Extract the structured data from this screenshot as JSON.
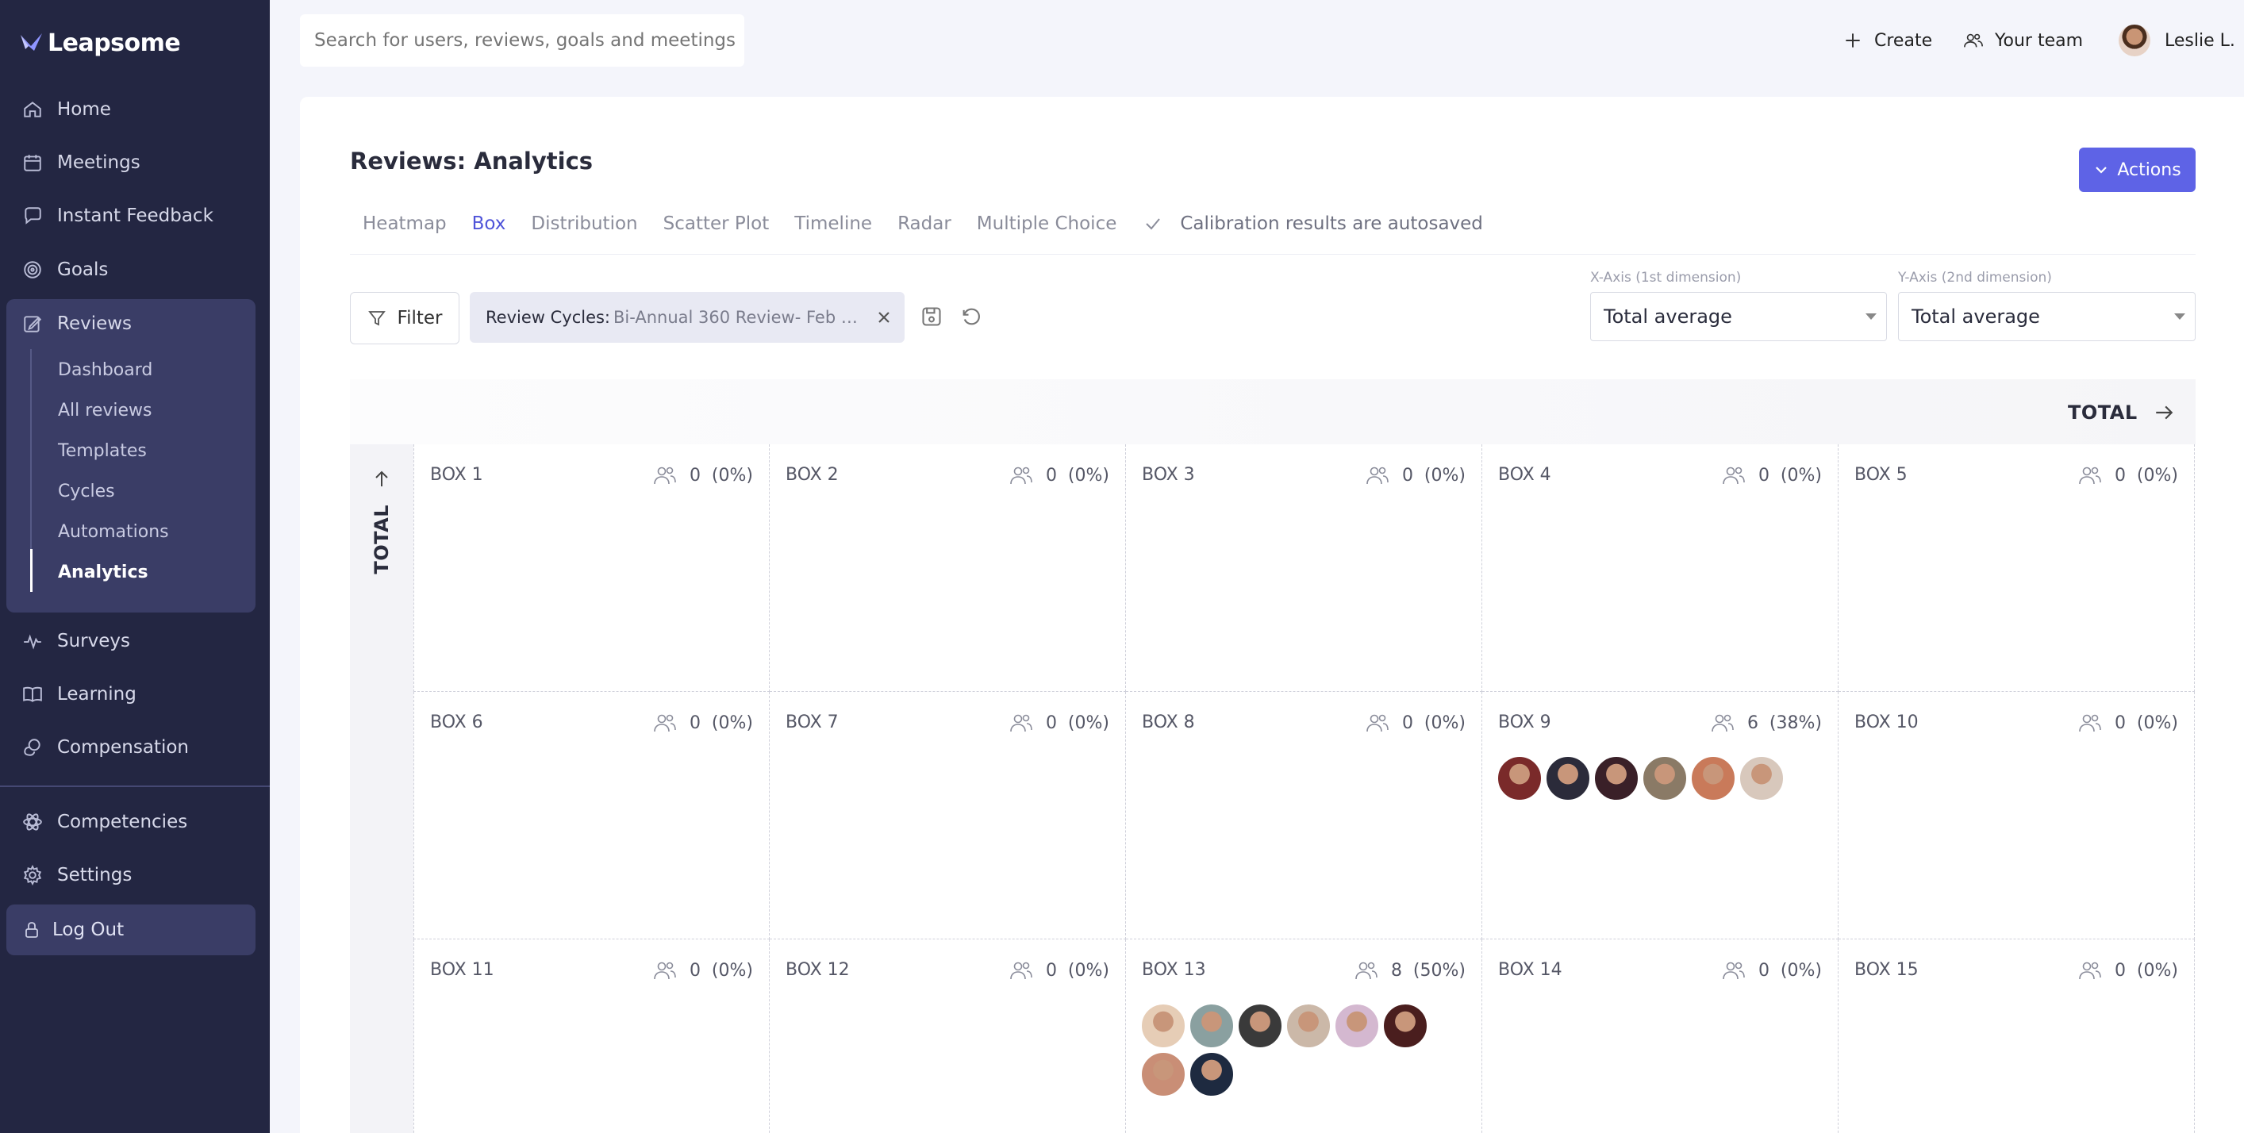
{
  "app": {
    "name": "Leapsome"
  },
  "sidebar": {
    "items": [
      {
        "id": "home",
        "label": "Home",
        "icon": "home-icon"
      },
      {
        "id": "meetings",
        "label": "Meetings",
        "icon": "calendar-icon"
      },
      {
        "id": "instant-feedback",
        "label": "Instant Feedback",
        "icon": "feedback-icon"
      },
      {
        "id": "goals",
        "label": "Goals",
        "icon": "target-icon"
      },
      {
        "id": "reviews",
        "label": "Reviews",
        "icon": "edit-icon"
      }
    ],
    "reviews_sub": [
      "Dashboard",
      "All reviews",
      "Templates",
      "Cycles",
      "Automations",
      "Analytics"
    ],
    "items_after": [
      {
        "id": "surveys",
        "label": "Surveys",
        "icon": "pulse-icon"
      },
      {
        "id": "learning",
        "label": "Learning",
        "icon": "book-icon"
      },
      {
        "id": "compensation",
        "label": "Compensation",
        "icon": "coins-icon"
      }
    ],
    "bottom": [
      {
        "id": "competencies",
        "label": "Competencies",
        "icon": "atom-icon"
      },
      {
        "id": "settings",
        "label": "Settings",
        "icon": "gear-icon"
      }
    ],
    "logout": "Log Out"
  },
  "topbar": {
    "search_placeholder": "Search for users, reviews, goals and meetings",
    "create": "Create",
    "your_team": "Your team",
    "user": "Leslie L."
  },
  "page": {
    "title": "Reviews: Analytics",
    "actions": "Actions",
    "tabs": [
      "Heatmap",
      "Box",
      "Distribution",
      "Scatter Plot",
      "Timeline",
      "Radar",
      "Multiple Choice"
    ],
    "active_tab": "Box",
    "autosave": "Calibration results are autosaved"
  },
  "filters": {
    "filter_label": "Filter",
    "chip_key": "Review Cycles:",
    "chip_value": "Bi-Annual 360 Review- Feb 1..."
  },
  "axes": {
    "x_label": "X-Axis (1st dimension)",
    "x_value": "Total average",
    "y_label": "Y-Axis (2nd dimension)",
    "y_value": "Total average"
  },
  "grid": {
    "x_header": "TOTAL",
    "y_header": "TOTAL",
    "boxes": [
      {
        "name": "BOX 1",
        "count": "0",
        "pct": "(0%)",
        "avatars": []
      },
      {
        "name": "BOX 2",
        "count": "0",
        "pct": "(0%)",
        "avatars": []
      },
      {
        "name": "BOX 3",
        "count": "0",
        "pct": "(0%)",
        "avatars": []
      },
      {
        "name": "BOX 4",
        "count": "0",
        "pct": "(0%)",
        "avatars": []
      },
      {
        "name": "BOX 5",
        "count": "0",
        "pct": "(0%)",
        "avatars": []
      },
      {
        "name": "BOX 6",
        "count": "0",
        "pct": "(0%)",
        "avatars": []
      },
      {
        "name": "BOX 7",
        "count": "0",
        "pct": "(0%)",
        "avatars": []
      },
      {
        "name": "BOX 8",
        "count": "0",
        "pct": "(0%)",
        "avatars": []
      },
      {
        "name": "BOX 9",
        "count": "6",
        "pct": "(38%)",
        "avatars": [
          "#7a2a2a",
          "#2b2b3a",
          "#3a2028",
          "#8a7a66",
          "#c97a5a",
          "#d8c8bc"
        ]
      },
      {
        "name": "BOX 10",
        "count": "0",
        "pct": "(0%)",
        "avatars": []
      },
      {
        "name": "BOX 11",
        "count": "0",
        "pct": "(0%)",
        "avatars": []
      },
      {
        "name": "BOX 12",
        "count": "0",
        "pct": "(0%)",
        "avatars": []
      },
      {
        "name": "BOX 13",
        "count": "8",
        "pct": "(50%)",
        "avatars": [
          "#e6cdb6",
          "#8aa0a0",
          "#3a3a3a",
          "#cbb8a8",
          "#d4b8d0",
          "#4a1e1e",
          "#c98e76",
          "#1e2a40"
        ]
      },
      {
        "name": "BOX 14",
        "count": "0",
        "pct": "(0%)",
        "avatars": []
      },
      {
        "name": "BOX 15",
        "count": "0",
        "pct": "(0%)",
        "avatars": []
      }
    ]
  },
  "colors": {
    "sidebar": "#232642",
    "accent": "#5e63e6",
    "active_tab": "#4f54d9"
  }
}
